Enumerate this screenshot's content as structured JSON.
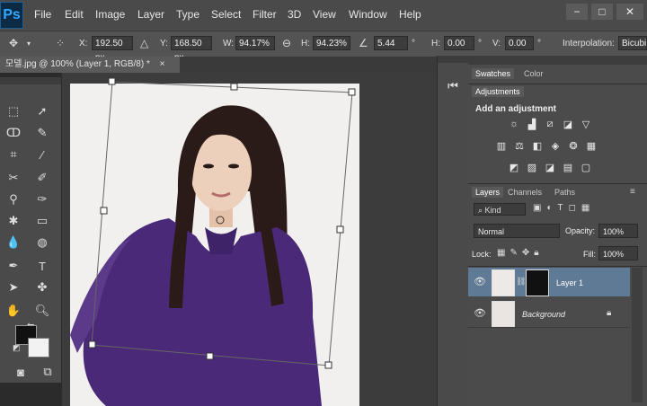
{
  "app": {
    "logo": "Ps",
    "menu": [
      "File",
      "Edit",
      "Image",
      "Layer",
      "Type",
      "Select",
      "Filter",
      "3D",
      "View",
      "Window",
      "Help"
    ],
    "window_controls": [
      "−",
      "□",
      "✕"
    ]
  },
  "options": {
    "x_label": "X:",
    "x_value": "192.50 px",
    "y_label": "Y:",
    "y_value": "168.50 px",
    "w_label": "W:",
    "w_value": "94.17%",
    "h_label": "H:",
    "h_value": "94.23%",
    "angle_value": "5.44",
    "angle_unit": "°",
    "hskew_label": "H:",
    "hskew_value": "0.00",
    "vskew_label": "V:",
    "vskew_value": "0.00",
    "interpolation_label": "Interpolation:",
    "interpolation_value": "Bicubi"
  },
  "document": {
    "tab_title": "모델.jpg @ 100% (Layer 1, RGB/8) *",
    "tab_close": "×"
  },
  "panels": {
    "top_tabs": [
      "Swatches",
      "Color"
    ],
    "adjustments_tab": "Adjustments",
    "add_adjustment": "Add an adjustment",
    "layers_tabs": [
      "Layers",
      "Channels",
      "Paths"
    ],
    "kind_filter": "Kind",
    "blend_mode": "Normal",
    "opacity_label": "Opacity:",
    "opacity_value": "100%",
    "lock_label": "Lock:",
    "fill_label": "Fill:",
    "fill_value": "100%",
    "layers": [
      {
        "name": "Layer 1",
        "selected": true
      },
      {
        "name": "Background",
        "selected": false
      }
    ]
  },
  "colors": {
    "accent_blue": "#31a8ff",
    "selected_layer": "#5f7a94",
    "foreground_swatch": "#111111",
    "background_swatch": "#f2f2f2"
  }
}
